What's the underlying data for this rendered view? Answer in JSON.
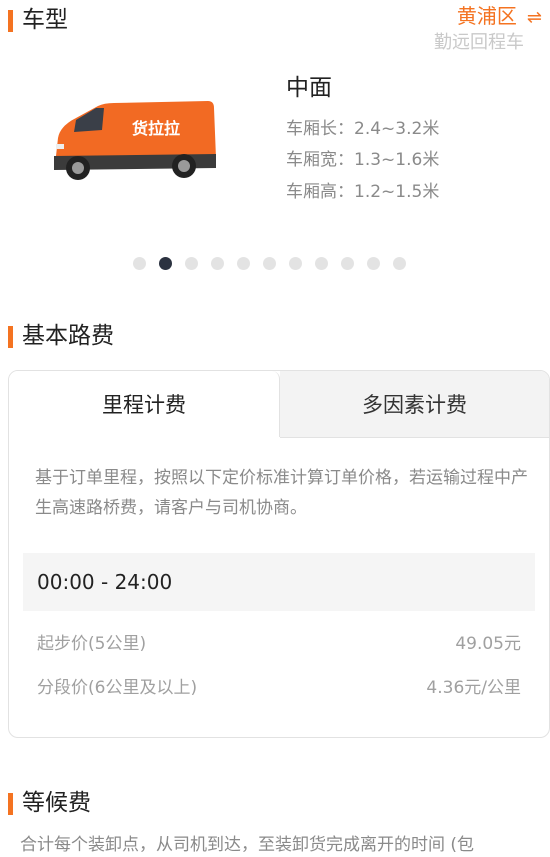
{
  "vehicle_section": {
    "title": "车型",
    "district": "黄浦区",
    "swap_icon": "⇌",
    "watermark": "勤远回程车",
    "van_brand_text": "货拉拉",
    "model_name": "中面",
    "specs": [
      "车厢长：2.4~3.2米",
      "车厢宽：1.3~1.6米",
      "车厢高：1.2~1.5米"
    ],
    "carousel_active_index": 1,
    "carousel_count": 11
  },
  "basic_fee": {
    "title": "基本路费",
    "tabs": [
      {
        "label": "里程计费",
        "active": true
      },
      {
        "label": "多因素计费",
        "active": false
      }
    ],
    "description": "基于订单里程，按照以下定价标准计算订单价格，若运输过程中产生高速路桥费，请客户与司机协商。",
    "time_range": "00:00 - 24:00",
    "rows": [
      {
        "label": "起步价(5公里)",
        "value": "49.05元"
      },
      {
        "label": "分段价(6公里及以上)",
        "value": "4.36元/公里"
      }
    ]
  },
  "waiting_fee": {
    "title": "等候费",
    "description": "合计每个装卸点，从司机到达，至装卸货完成离开的时间 (包"
  },
  "colors": {
    "accent": "#f47321",
    "dot_active": "#2b3240"
  }
}
